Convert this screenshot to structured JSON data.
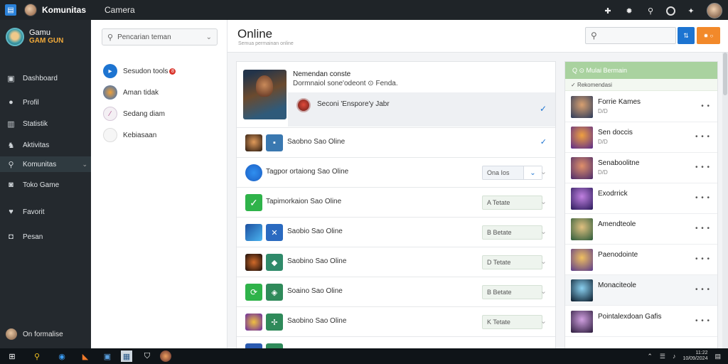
{
  "titlebar": {
    "name": "Komunitas",
    "tab": "Camera"
  },
  "leftnav": {
    "brand_line1": "Gamu",
    "brand_line2": "GAM GUN",
    "items": [
      {
        "label": "Dashboard",
        "icon": "monitor-icon"
      },
      {
        "label": "Profil",
        "icon": "user-icon"
      },
      {
        "label": "Statistik",
        "icon": "chart-icon"
      },
      {
        "label": "Aktivitas",
        "icon": "gamepad-icon"
      },
      {
        "label": "Komunitas",
        "icon": "search-user-icon"
      },
      {
        "label": "Toko Game",
        "icon": "store-icon"
      },
      {
        "label": "Favorit",
        "icon": "heart-icon"
      },
      {
        "label": "Pesan",
        "icon": "chat-icon"
      }
    ],
    "footer": "On formalise"
  },
  "friends": {
    "search_placeholder": "Pencarian teman",
    "items": [
      {
        "label": "Sesudon tools",
        "badge": "8"
      },
      {
        "label": "Aman tidak"
      },
      {
        "label": "Sedang diam"
      },
      {
        "label": "Kebiasaan"
      }
    ]
  },
  "header": {
    "title": "Online",
    "subtitle": "Semua permainan online"
  },
  "list": {
    "featured": {
      "title": "Nemendan conste",
      "subtitle": "Dormnaiol sone'odeont ⊙ Fenda.",
      "row_text": "Seconi 'Enspore'y Jabr"
    },
    "rows": [
      {
        "label": "Saobno Sao Oline",
        "pill": "",
        "check": "✓"
      },
      {
        "label": "Tagpor ortaiong Sao Oline",
        "pill": "Ona Ios",
        "check": "⌄"
      },
      {
        "label": "Tapimorkaion Sao Oline",
        "pill": "A Tetate",
        "check": "⌄"
      },
      {
        "label": "Saobio Sao Oline",
        "pill": "B Betate",
        "check": "⌄"
      },
      {
        "label": "Saobino Sao Oline",
        "pill": "D Tetate",
        "check": "⌄"
      },
      {
        "label": "Soaino Sao Oline",
        "pill": "B Betate",
        "check": "⌄"
      },
      {
        "label": "Saobino Sao Oline",
        "pill": "K Tetate",
        "check": "⌄"
      }
    ]
  },
  "rightpanel": {
    "header": "Q ⊙ Mulai Bermain",
    "tag": "Rekomendasi",
    "items": [
      {
        "name": "Forrie Kames",
        "sub": "D/D",
        "more": "• •"
      },
      {
        "name": "Sen doccis",
        "sub": "D/D",
        "more": "• • •"
      },
      {
        "name": "Senaboolitne",
        "sub": "D/D",
        "more": "• • •"
      },
      {
        "name": "Exodrrick",
        "sub": "",
        "more": "• • •"
      },
      {
        "name": "Amendteole",
        "sub": "",
        "more": "• • •"
      },
      {
        "name": "Paenodointe",
        "sub": "",
        "more": "• • •"
      },
      {
        "name": "Monaciteole",
        "sub": "",
        "more": "• • •"
      },
      {
        "name": "Pointalexdoan Gafis",
        "sub": "",
        "more": "• • •"
      }
    ]
  },
  "taskbar": {
    "clock_line1": "11:22",
    "clock_line2": "10/09/2024"
  }
}
